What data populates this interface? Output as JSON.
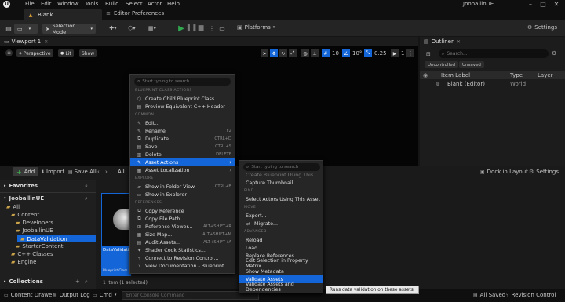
{
  "titlebar": {
    "menus": [
      "File",
      "Edit",
      "Window",
      "Tools",
      "Build",
      "Select",
      "Actor",
      "Help"
    ],
    "project_name": "JooballinUE"
  },
  "tabs": {
    "level_tab": "Blank",
    "editor_prefs": "Editor Preferences"
  },
  "toolbar": {
    "selection_mode": "Selection Mode",
    "platforms": "Platforms",
    "settings": "Settings"
  },
  "viewport": {
    "tab_label": "Viewport 1",
    "perspective": "Perspective",
    "lit": "Lit",
    "show": "Show",
    "grid_value": "10",
    "angle_value": "10°",
    "scale_value": "0.25",
    "camera_value": "1"
  },
  "outliner": {
    "title": "Outliner",
    "search_placeholder": "Search...",
    "filter_uncontrolled": "Uncontrolled",
    "filter_unsaved": "Unsaved",
    "col_item": "Item Label",
    "col_type": "Type",
    "col_layer": "Layer",
    "row_label": "Blank (Editor)",
    "row_type": "World"
  },
  "content_browser": {
    "add": "Add",
    "import": "Import",
    "save_all": "Save All",
    "all": "All",
    "dock": "Dock in Layout",
    "settings": "Settings",
    "favorites": "Favorites",
    "root": "JooballinUE",
    "tree": [
      "All",
      "Content",
      "Developers",
      "JooballinUE",
      "DataValidation",
      "StarterContent",
      "C++ Classes",
      "Engine"
    ],
    "collections": "Collections",
    "asset_name": "DataValidation",
    "asset_type": "Blueprint Class",
    "item_count": "1 item (1 selected)"
  },
  "status": {
    "content_drawer": "Content Drawer",
    "output_log": "Output Log",
    "cmd": "Cmd",
    "console_placeholder": "Enter Console Command",
    "all_saved": "All Saved",
    "revision": "Revision Control"
  },
  "context_menu": {
    "search_placeholder": "Start typing to search",
    "sections": {
      "bp": "BLUEPRINT CLASS ACTIONS",
      "common": "COMMON",
      "explore": "EXPLORE",
      "references": "REFERENCES"
    },
    "items": {
      "create_child": "Create Child Blueprint Class",
      "preview_cpp": "Preview Equivalent C++ Header",
      "edit": "Edit...",
      "rename": "Rename",
      "duplicate": "Duplicate",
      "save": "Save",
      "delete": "Delete",
      "asset_actions": "Asset Actions",
      "asset_localization": "Asset Localization",
      "show_folder": "Show in Folder View",
      "show_explorer": "Show in Explorer",
      "copy_ref": "Copy Reference",
      "copy_path": "Copy File Path",
      "ref_viewer": "Reference Viewer...",
      "size_map": "Size Map...",
      "audit": "Audit Assets...",
      "shader_stats": "Shader Cook Statistics...",
      "revision": "Connect to Revision Control...",
      "docs": "View Documentation - Blueprint"
    },
    "shortcuts": {
      "rename": "F2",
      "duplicate": "CTRL+D",
      "save": "CTRL+S",
      "delete": "DELETE",
      "show_folder": "CTRL+B",
      "ref_viewer": "ALT+SHIFT+R",
      "size_map": "ALT+SHIFT+M",
      "audit": "ALT+SHIFT+A"
    }
  },
  "submenu": {
    "search_placeholder": "Start typing to search",
    "sections": {
      "find": "FIND",
      "move": "MOVE",
      "advanced": "ADVANCED"
    },
    "items": {
      "create_bp_using": "Create Blueprint Using This...",
      "capture_thumb": "Capture Thumbnail",
      "select_actors": "Select Actors Using This Asset",
      "export": "Export...",
      "migrate": "Migrate...",
      "reload": "Reload",
      "load": "Load",
      "replace_refs": "Replace References",
      "edit_matrix": "Edit Selection in Property Matrix",
      "show_metadata": "Show Metadata",
      "validate": "Validate Assets",
      "validate_deps": "Validate Assets and Dependencies"
    },
    "tooltip": "Runs data validation on these assets."
  },
  "colors": {
    "accent": "#1466d8",
    "play": "#2fa84f",
    "add": "#2a7a2a"
  }
}
